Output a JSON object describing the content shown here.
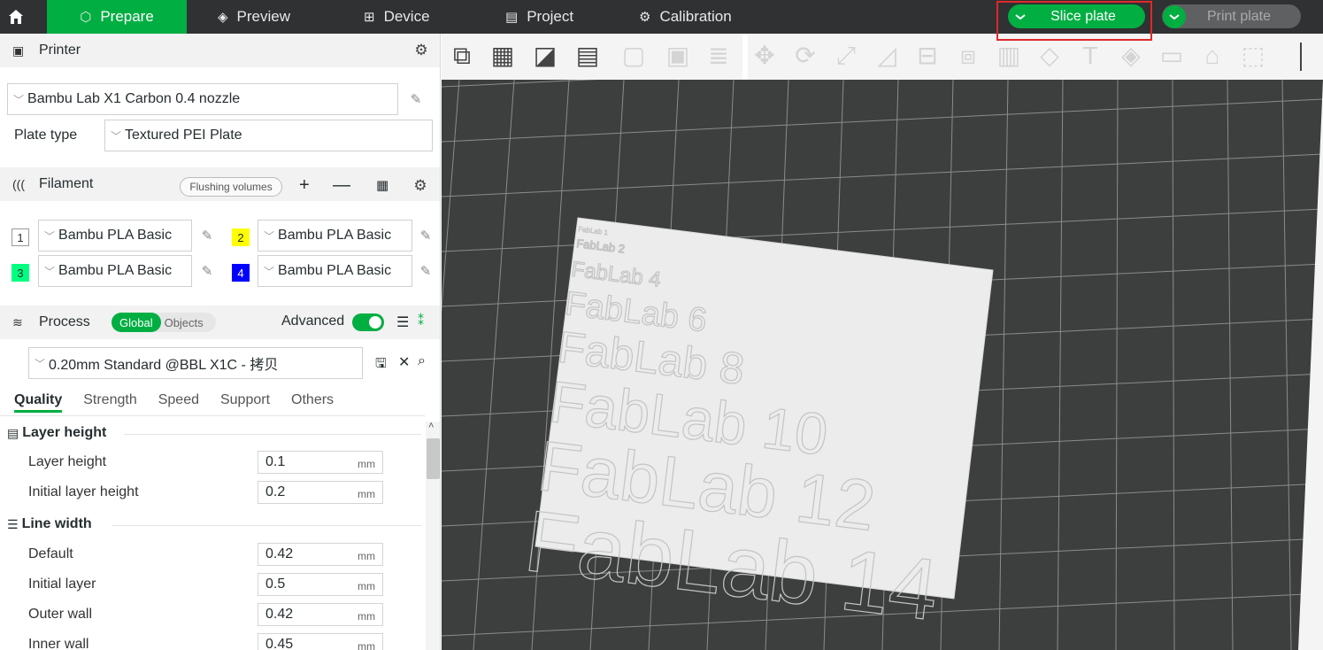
{
  "topbar": {
    "home_icon": "home-icon",
    "tabs": [
      {
        "label": "Prepare",
        "icon": "cube-icon"
      },
      {
        "label": "Preview",
        "icon": "layers-icon"
      },
      {
        "label": "Device",
        "icon": "device-icon"
      },
      {
        "label": "Project",
        "icon": "project-icon"
      },
      {
        "label": "Calibration",
        "icon": "calibration-icon"
      }
    ],
    "slice_label": "Slice plate",
    "print_label": "Print plate",
    "accent": "#00ae42",
    "highlight": "#e0282a"
  },
  "printer": {
    "title": "Printer",
    "selected": "Bambu Lab X1 Carbon 0.4 nozzle",
    "plate_type_label": "Plate type",
    "plate_type": "Textured PEI Plate"
  },
  "filament": {
    "title": "Filament",
    "flush_label": "Flushing volumes",
    "slots": [
      {
        "num": "1",
        "name": "Bambu PLA Basic",
        "color": "#ffffff"
      },
      {
        "num": "2",
        "name": "Bambu PLA Basic",
        "color": "#ffff00"
      },
      {
        "num": "3",
        "name": "Bambu PLA Basic",
        "color": "#00ff80"
      },
      {
        "num": "4",
        "name": "Bambu PLA Basic",
        "color": "#0000ff"
      }
    ]
  },
  "process": {
    "title": "Process",
    "global_label": "Global",
    "objects_label": "Objects",
    "advanced_label": "Advanced",
    "preset": "0.20mm Standard @BBL X1C - 拷贝",
    "tabs": [
      "Quality",
      "Strength",
      "Speed",
      "Support",
      "Others"
    ]
  },
  "settings": {
    "layer_height_group": "Layer height",
    "layer_height_label": "Layer height",
    "layer_height": "0.1",
    "initial_layer_height_label": "Initial layer height",
    "initial_layer_height": "0.2",
    "line_width_group": "Line width",
    "default_label": "Default",
    "default": "0.42",
    "initial_layer_label": "Initial layer",
    "initial_layer": "0.5",
    "outer_wall_label": "Outer wall",
    "outer_wall": "0.42",
    "inner_wall_label": "Inner wall",
    "inner_wall": "0.45",
    "unit": "mm"
  },
  "plate": {
    "texts": [
      "FabLab 1",
      "FabLab 2",
      "FabLab 4",
      "FabLab 6",
      "FabLab 8",
      "FabLab 10",
      "FabLab 12",
      "FabLab 14"
    ]
  }
}
